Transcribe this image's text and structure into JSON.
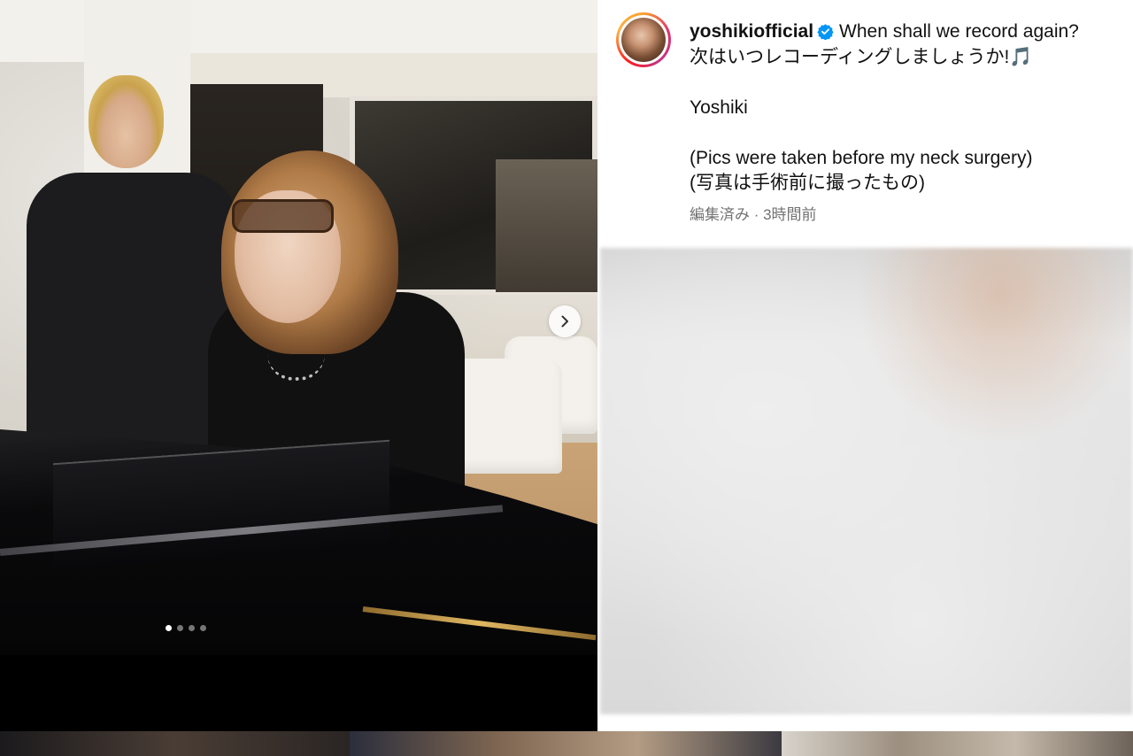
{
  "post": {
    "username": "yoshikiofficial",
    "verified": true,
    "caption_lines": [
      "When shall we record again?",
      "次はいつレコーディングしましょうか!🎵",
      "",
      "Yoshiki",
      "",
      "(Pics were taken before my neck surgery)",
      "(写真は手術前に撮ったもの)"
    ],
    "meta": "編集済み · 3時間前"
  },
  "carousel": {
    "slide_count": 4,
    "active_index": 0,
    "next_icon": "chevron-right-icon"
  },
  "colors": {
    "verified_badge": "#0095f6",
    "meta_text": "#737373"
  }
}
